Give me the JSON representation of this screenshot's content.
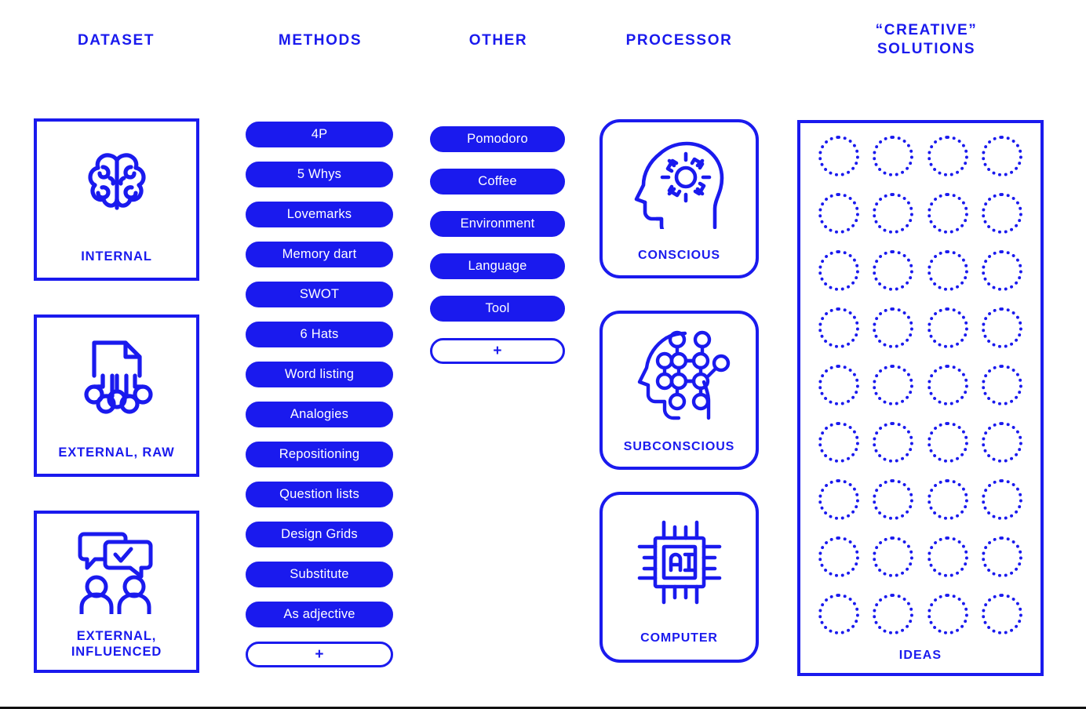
{
  "columns": {
    "dataset": "DATASET",
    "methods": "METHODS",
    "other": "OTHER",
    "processor": "PROCESSOR",
    "creative": "“CREATIVE”\nSOLUTIONS"
  },
  "colors": {
    "accent": "#1a1aee",
    "pill_text": "#ffffff",
    "background": "#ffffff",
    "bottom_rule": "#111111"
  },
  "dataset": {
    "cards": [
      {
        "label": "INTERNAL",
        "icon": "brain-icon"
      },
      {
        "label": "EXTERNAL, RAW",
        "icon": "document-circuit-icon"
      },
      {
        "label": "EXTERNAL,\nINFLUENCED",
        "icon": "people-speech-bubbles-icon"
      }
    ]
  },
  "methods": {
    "items": [
      "4P",
      "5 Whys",
      "Lovemarks",
      "Memory dart",
      "SWOT",
      "6 Hats",
      "Word listing",
      "Analogies",
      "Repositioning",
      "Question lists",
      "Design Grids",
      "Substitute",
      "As adjective"
    ],
    "add_label": "+"
  },
  "other": {
    "items": [
      "Pomodoro",
      "Coffee",
      "Environment",
      "Language",
      "Tool"
    ],
    "add_label": "+"
  },
  "processor": {
    "cards": [
      {
        "label": "CONSCIOUS",
        "icon": "head-gear-icon"
      },
      {
        "label": "SUBCONSCIOUS",
        "icon": "head-network-icon"
      },
      {
        "label": "COMPUTER",
        "icon": "ai-chip-icon"
      }
    ]
  },
  "ideas": {
    "label": "IDEAS",
    "rows": 9,
    "columns": 4,
    "slot_count": 36,
    "slot_style": "dotted-circle"
  }
}
